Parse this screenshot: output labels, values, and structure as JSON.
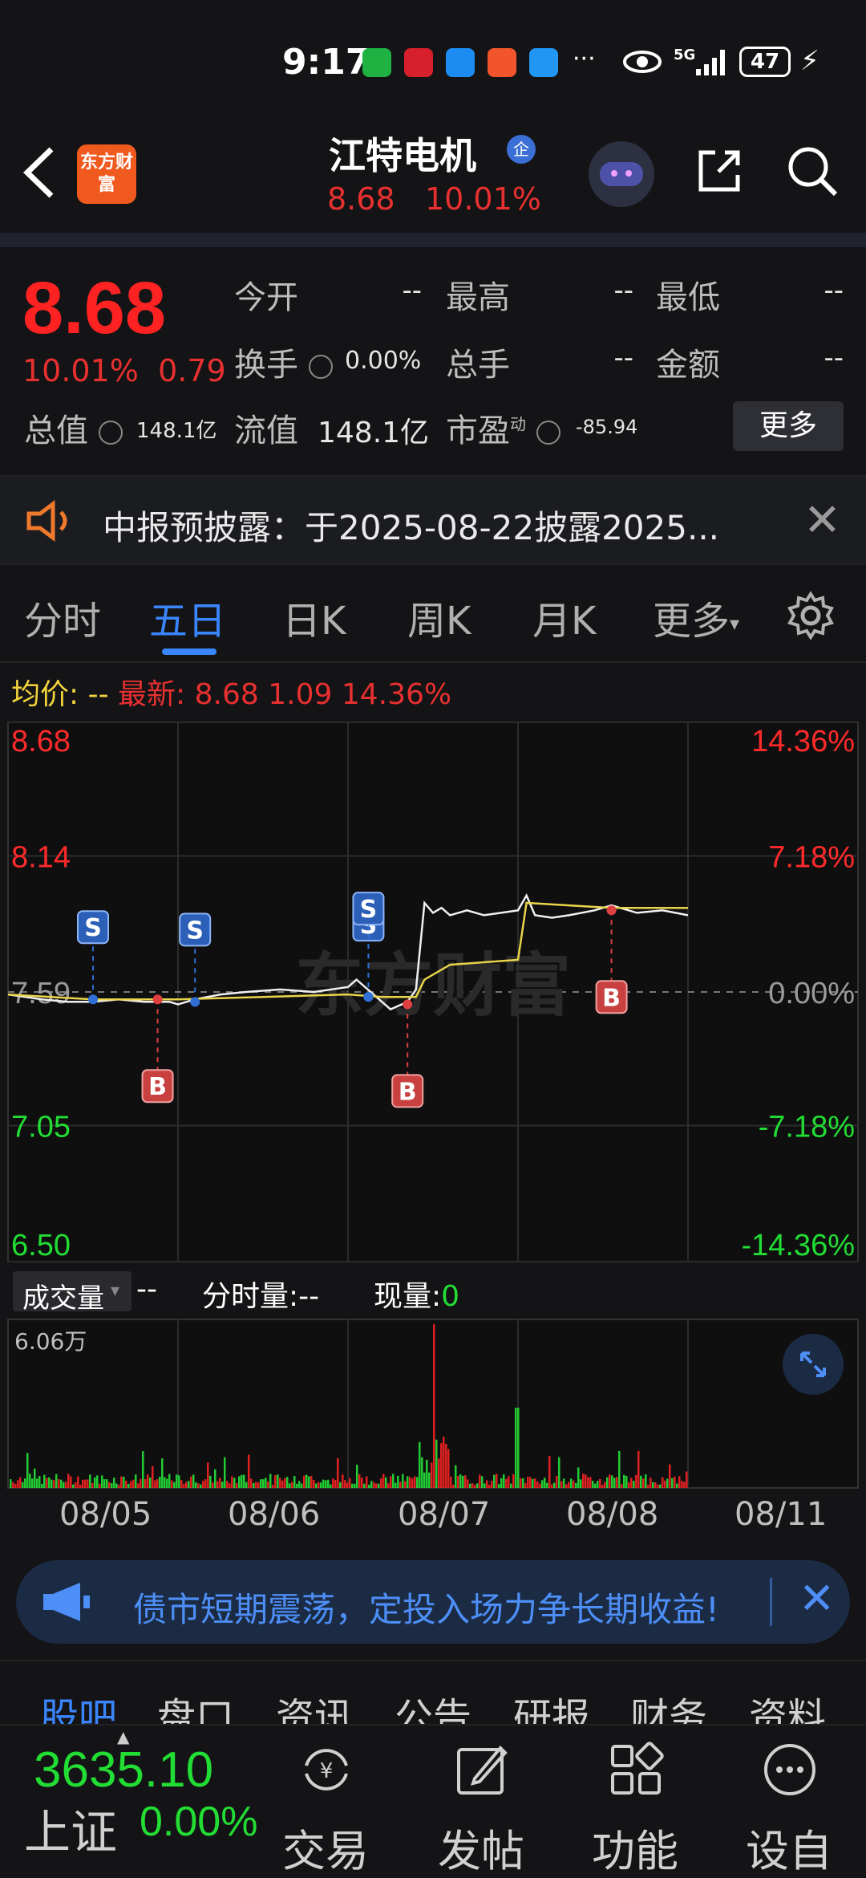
{
  "status_bar": {
    "time": "9:17",
    "network": "5G",
    "battery": "47"
  },
  "header": {
    "app_logo_text": "东方财富",
    "stock_name": "江特电机",
    "badge": "企",
    "price": "8.68",
    "pct": "10.01%"
  },
  "quote": {
    "price": "8.68",
    "change_pct": "10.01%",
    "change_abs": "0.79",
    "fields": {
      "open_label": "今开",
      "open_value": "--",
      "high_label": "最高",
      "high_value": "--",
      "low_label": "最低",
      "low_value": "--",
      "turnover_label": "换手",
      "turnover_value": "0.00%",
      "volume_label": "总手",
      "volume_value": "--",
      "amount_label": "金额",
      "amount_value": "--",
      "mktcap_label": "总值",
      "mktcap_value": "148.1亿",
      "float_label": "流值",
      "float_value": "148.1亿",
      "pe_label": "市盈",
      "pe_sup": "动",
      "pe_value": "-85.94"
    },
    "more_button": "更多"
  },
  "notice": {
    "text": "中报预披露：于2025-08-22披露2025..."
  },
  "tabs": [
    "分时",
    "五日",
    "日K",
    "周K",
    "月K",
    "更多"
  ],
  "active_tab": 1,
  "legend": {
    "avg_label": "均价:",
    "avg_value": "--",
    "latest_label": "最新:",
    "latest_price": "8.68",
    "latest_change": "1.09",
    "latest_pct": "14.36%"
  },
  "watermark": "东方财富",
  "chart_data": {
    "type": "line",
    "title": "",
    "y_left_ticks": [
      "8.68",
      "8.14",
      "7.59",
      "7.05",
      "6.50"
    ],
    "y_right_ticks": [
      "14.36%",
      "7.18%",
      "0.00%",
      "-7.18%",
      "-14.36%"
    ],
    "ylim": [
      6.5,
      8.68
    ],
    "x_labels": [
      "08/05",
      "08/06",
      "08/07",
      "08/08",
      "08/11"
    ],
    "x_range": [
      0,
      5
    ],
    "series": [
      {
        "name": "",
        "x": [
          0.0,
          0.1,
          0.2,
          0.35,
          0.5,
          0.65,
          0.8,
          0.95,
          1.0,
          1.1,
          1.25,
          1.4,
          1.6,
          1.8,
          2.0,
          2.05,
          2.15,
          2.25,
          2.35,
          2.4,
          2.45,
          2.5,
          2.55,
          2.6,
          2.7,
          2.8,
          2.9,
          3.0,
          3.05,
          3.1,
          3.2,
          3.3,
          3.45,
          3.55,
          3.7,
          3.85,
          4.0
        ],
        "values": [
          7.58,
          7.57,
          7.56,
          7.55,
          7.55,
          7.56,
          7.55,
          7.55,
          7.54,
          7.56,
          7.58,
          7.59,
          7.6,
          7.59,
          7.61,
          7.64,
          7.58,
          7.52,
          7.55,
          7.6,
          7.95,
          7.91,
          7.93,
          7.9,
          7.92,
          7.9,
          7.91,
          7.92,
          7.98,
          7.9,
          7.89,
          7.9,
          7.92,
          7.94,
          7.91,
          7.92,
          7.9
        ]
      },
      {
        "name": "",
        "x": [
          0.0,
          0.5,
          1.0,
          1.5,
          2.0,
          2.2,
          2.4,
          2.45,
          2.6,
          2.8,
          3.0,
          3.05,
          3.3,
          3.55,
          4.0
        ],
        "values": [
          7.58,
          7.56,
          7.56,
          7.57,
          7.58,
          7.57,
          7.57,
          7.64,
          7.7,
          7.71,
          7.72,
          7.95,
          7.94,
          7.93,
          7.93
        ]
      }
    ],
    "markers": [
      {
        "label": "S",
        "x": 0.5,
        "y": 7.56,
        "side": "above"
      },
      {
        "label": "B",
        "x": 0.88,
        "y": 7.56,
        "side": "below"
      },
      {
        "label": "S",
        "x": 1.1,
        "y": 7.55,
        "side": "above"
      },
      {
        "label": "S",
        "x": 2.12,
        "y": 7.57,
        "side": "above"
      },
      {
        "label": "S",
        "x": 2.12,
        "y": 7.57,
        "side": "above2"
      },
      {
        "label": "B",
        "x": 2.35,
        "y": 7.54,
        "side": "below"
      },
      {
        "label": "B",
        "x": 3.55,
        "y": 7.92,
        "side": "below"
      }
    ]
  },
  "volume": {
    "selector": "成交量",
    "value": "--",
    "fenshi_label": "分时量:",
    "fenshi_value": "--",
    "xianliang_label": "现量:",
    "xianliang_value": "0",
    "max_label": "6.06万"
  },
  "ad_banner": {
    "text": "债市短期震荡，定投入场力争长期收益!"
  },
  "sub_tabs": [
    "股吧",
    "盘口",
    "资讯",
    "公告",
    "研报",
    "财务",
    "资料"
  ],
  "index": {
    "value": "3635.10",
    "name": "上证",
    "pct": "0.00%"
  },
  "bottom_nav": [
    "交易",
    "发帖",
    "功能",
    "设自选"
  ]
}
